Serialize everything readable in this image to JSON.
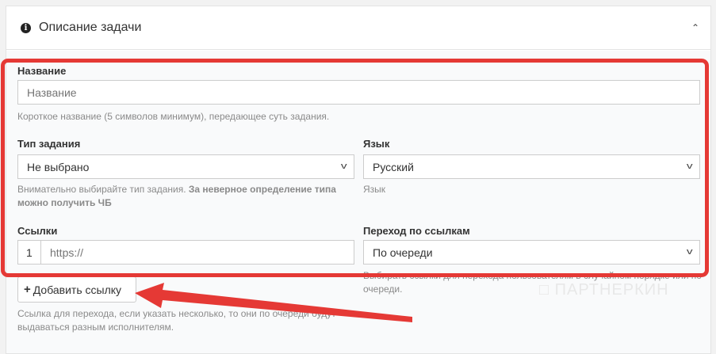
{
  "card": {
    "title": "Описание задачи",
    "info_icon": "info-circle-icon",
    "collapse_icon": "chevron-up-icon"
  },
  "name_field": {
    "label": "Название",
    "placeholder": "Название",
    "help": "Короткое название (5 символов минимум), передающее суть задания."
  },
  "task_type": {
    "label": "Тип задания",
    "value": "Не выбрано",
    "help_normal": "Внимательно выбирайте тип задания.",
    "help_bold": "За неверное определение типа можно получить ЧБ"
  },
  "language": {
    "label": "Язык",
    "value": "Русский",
    "help": "Язык"
  },
  "links": {
    "label": "Ссылки",
    "index": "1",
    "placeholder": "https://",
    "add_button": "Добавить ссылку",
    "help": "Ссылка для перехода, если указать несколько, то они по очереди будут выдаваться разным исполнителям."
  },
  "link_transition": {
    "label": "Переход по ссылкам",
    "value": "По очереди",
    "help": "Выбирать ссылки для перехода пользователям в случайном порядке или по очереди."
  },
  "watermark": "ПАРТНЕРКИН",
  "annotation_color": "#e53935"
}
